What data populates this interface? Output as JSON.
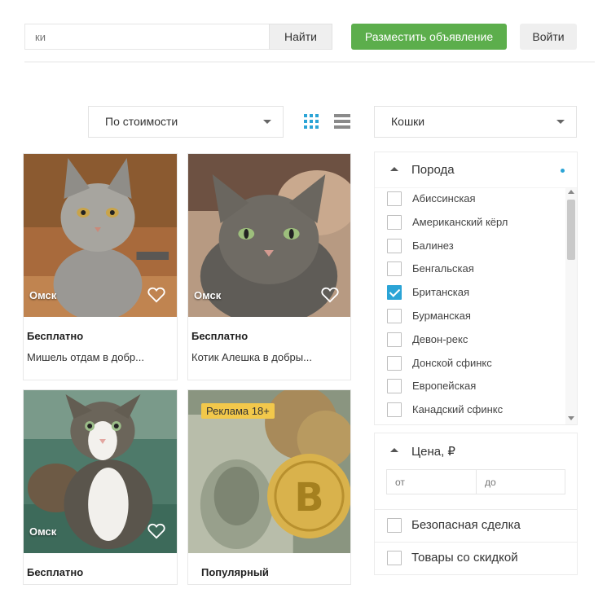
{
  "header": {
    "search_placeholder": "ки",
    "search_button": "Найти",
    "post_button": "Разместить объявление",
    "login_button": "Войти"
  },
  "toolbar": {
    "sort_value": "По стоимости",
    "category_value": "Кошки",
    "view_grid_icon": "grid-view-icon",
    "view_list_icon": "list-view-icon",
    "active_color": "#2ba4d6"
  },
  "listings": [
    {
      "city": "Омск",
      "price": "Бесплатно",
      "title": "Мишель отдам в добр...",
      "ad_badge": ""
    },
    {
      "city": "Омск",
      "price": "Бесплатно",
      "title": "Котик Алешка в добры...",
      "ad_badge": ""
    },
    {
      "city": "Омск",
      "price": "Бесплатно",
      "title": "",
      "ad_badge": ""
    },
    {
      "city": "",
      "price": "Популярный",
      "title": "",
      "ad_badge": "Реклама 18+"
    }
  ],
  "filters": {
    "breed_title": "Порода",
    "breeds": [
      {
        "name": "Абиссинская",
        "checked": false
      },
      {
        "name": "Американский кёрл",
        "checked": false
      },
      {
        "name": "Балинез",
        "checked": false
      },
      {
        "name": "Бенгальская",
        "checked": false
      },
      {
        "name": "Британская",
        "checked": true
      },
      {
        "name": "Бурманская",
        "checked": false
      },
      {
        "name": "Девон-рекс",
        "checked": false
      },
      {
        "name": "Донской сфинкс",
        "checked": false
      },
      {
        "name": "Европейская",
        "checked": false
      },
      {
        "name": "Канадский сфинкс",
        "checked": false
      }
    ],
    "price_title": "Цена, ₽",
    "price_from_placeholder": "от",
    "price_to_placeholder": "до",
    "safe_deal_label": "Безопасная сделка",
    "discount_label": "Товары со скидкой"
  },
  "colors": {
    "post_button": "#5cae4c",
    "checkbox_active": "#2ba4d6",
    "ad_badge": "#f2c84b"
  }
}
